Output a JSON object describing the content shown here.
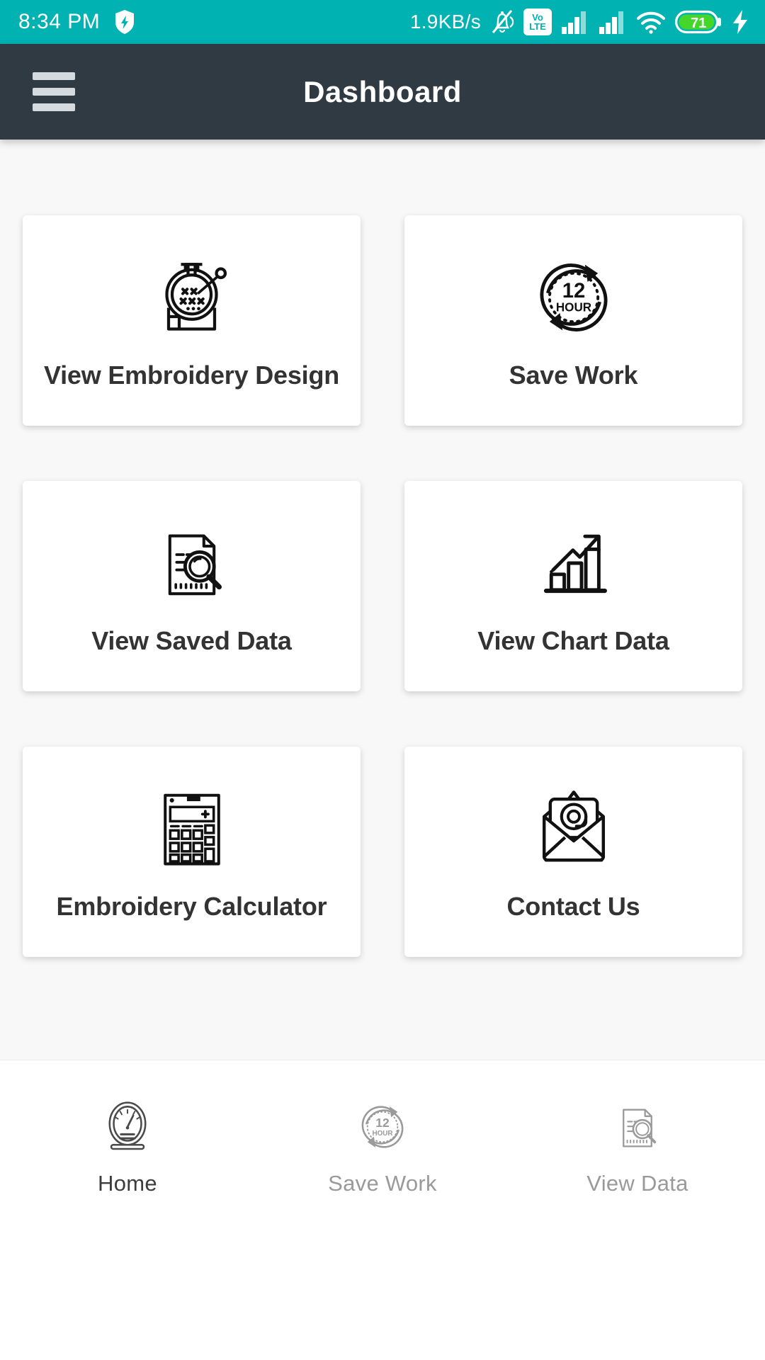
{
  "status_bar": {
    "time": "8:34 PM",
    "shield_icon": "shield-icon",
    "network_speed": "1.9KB/s",
    "mute_icon": "bell-muted-icon",
    "volte_top": "Vo",
    "volte_bottom": "LTE",
    "signal_1_icon": "signal-bars-icon",
    "signal_2_icon": "signal-bars-icon",
    "wifi_icon": "wifi-icon",
    "battery_level": "71",
    "charging_icon": "charging-bolt-icon",
    "background_color": "#00b2b2"
  },
  "app_bar": {
    "menu_icon": "hamburger-menu-icon",
    "title": "Dashboard",
    "background_color": "#303a42",
    "title_color": "#ffffff"
  },
  "main": {
    "background_color": "#f8f8f8",
    "cards": [
      {
        "label": "View Embroidery Design",
        "icon": "embroidery-hoop-icon"
      },
      {
        "label": "Save Work",
        "icon": "twelve-hour-refresh-icon"
      },
      {
        "label": "View Saved Data",
        "icon": "document-search-icon"
      },
      {
        "label": "View Chart Data",
        "icon": "bar-chart-growth-icon"
      },
      {
        "label": "Embroidery Calculator",
        "icon": "calculator-icon"
      },
      {
        "label": "Contact Us",
        "icon": "open-envelope-at-icon"
      }
    ]
  },
  "bottom_nav": {
    "items": [
      {
        "label": "Home",
        "icon": "speedometer-gauge-icon",
        "active": true
      },
      {
        "label": "Save Work",
        "icon": "twelve-hour-refresh-icon",
        "active": false
      },
      {
        "label": "View Data",
        "icon": "document-search-icon",
        "active": false
      }
    ],
    "active_color": "#3d3d3d",
    "inactive_color": "#9a9a9a"
  }
}
